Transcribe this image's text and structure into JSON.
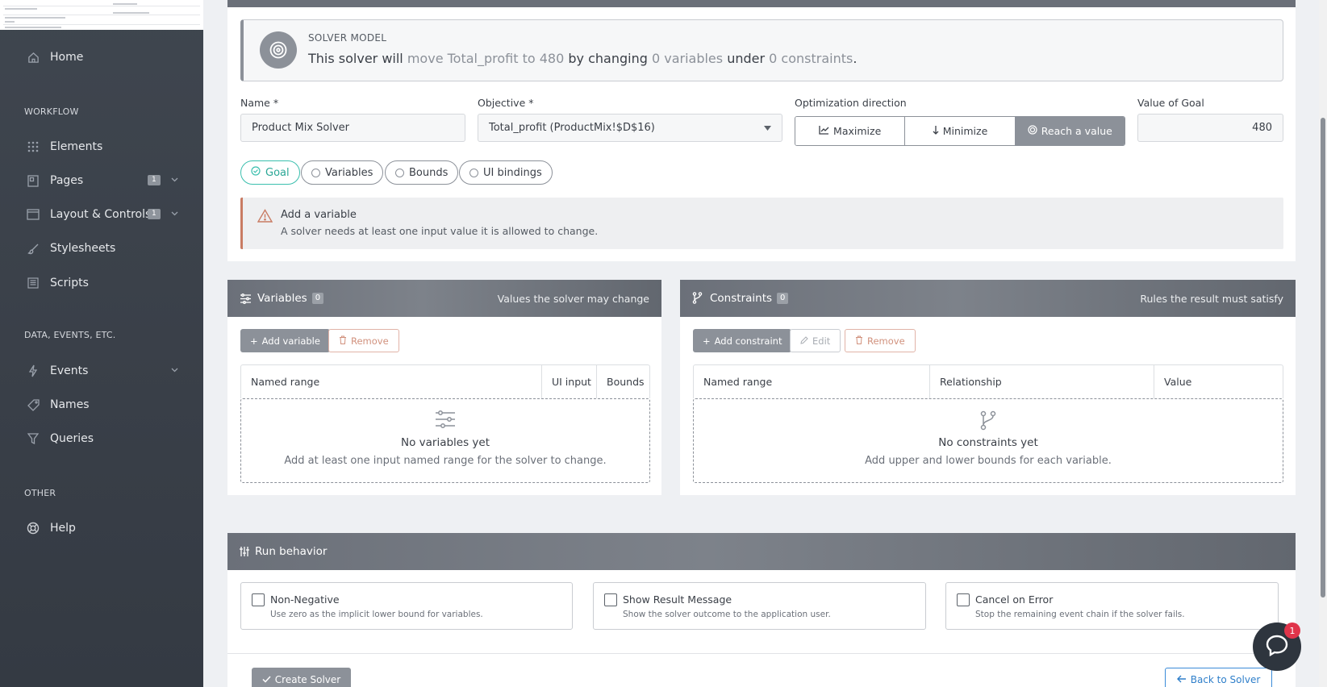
{
  "sidebar": {
    "home": "Home",
    "section_workflow": "WORKFLOW",
    "elements": "Elements",
    "pages": "Pages",
    "pages_badge": "1",
    "layout": "Layout & Controls",
    "layout_badge": "1",
    "stylesheets": "Stylesheets",
    "scripts": "Scripts",
    "section_data": "DATA, EVENTS, ETC.",
    "events": "Events",
    "names": "Names",
    "queries": "Queries",
    "section_other": "OTHER",
    "help": "Help"
  },
  "model": {
    "kicker": "SOLVER MODEL",
    "s1": "This solver will ",
    "s2": "move Total_profit to 480",
    "s3": " by changing ",
    "s4": "0 variables",
    "s5": " under ",
    "s6": "0 constraints",
    "s7": "."
  },
  "form": {
    "name_label": "Name *",
    "name_value": "Product Mix Solver",
    "objective_label": "Objective *",
    "objective_value": "Total_profit (ProductMix!$D$16)",
    "direction_label": "Optimization direction",
    "maximize": "Maximize",
    "minimize": "Minimize",
    "reach": "Reach a value",
    "goal_label": "Value of Goal",
    "goal_value": "480"
  },
  "tabs": {
    "goal": "Goal",
    "variables": "Variables",
    "bounds": "Bounds",
    "ui_bindings": "UI bindings"
  },
  "alert": {
    "title": "Add a variable",
    "text": "A solver needs at least one input value it is allowed to change."
  },
  "variables_panel": {
    "title": "Variables",
    "count": "0",
    "subtitle": "Values the solver may change",
    "add": "Add variable",
    "remove": "Remove",
    "columns": [
      "Named range",
      "UI input",
      "Bounds"
    ],
    "empty_title": "No variables yet",
    "empty_text": "Add at least one input named range for the solver to change."
  },
  "constraints_panel": {
    "title": "Constraints",
    "count": "0",
    "subtitle": "Rules the result must satisfy",
    "add": "Add constraint",
    "edit": "Edit",
    "remove": "Remove",
    "columns": [
      "Named range",
      "Relationship",
      "Value"
    ],
    "empty_title": "No constraints yet",
    "empty_text": "Add upper and lower bounds for each variable."
  },
  "run": {
    "title": "Run behavior",
    "options": [
      {
        "title": "Non-Negative",
        "desc": "Use zero as the implicit lower bound for variables."
      },
      {
        "title": "Show Result Message",
        "desc": "Show the solver outcome to the application user."
      },
      {
        "title": "Cancel on Error",
        "desc": "Stop the remaining event chain if the solver fails."
      }
    ]
  },
  "footer": {
    "create": "Create Solver",
    "back": "Back to Solver"
  },
  "chat_badge": "1",
  "colors": {
    "sidebar": "#3a4049",
    "accent_gray": "#8c9199",
    "teal": "#3bbfae",
    "warning": "#c97b63",
    "link_blue": "#2f7fca",
    "badge_red": "#e0344a"
  }
}
